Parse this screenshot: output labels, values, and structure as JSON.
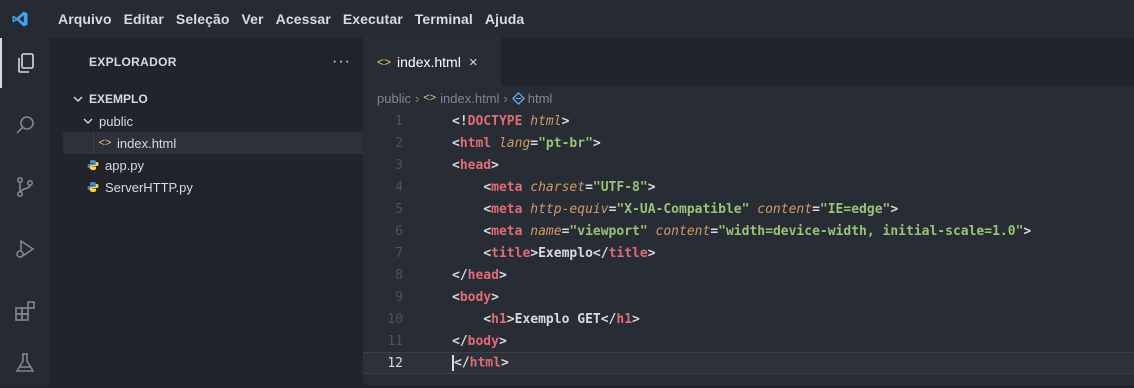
{
  "menu": {
    "items": [
      "Arquivo",
      "Editar",
      "Seleção",
      "Ver",
      "Acessar",
      "Executar",
      "Terminal",
      "Ajuda"
    ]
  },
  "activity_bar": {
    "icons": [
      "explorer-icon",
      "search-icon",
      "source-control-icon",
      "run-debug-icon",
      "extensions-icon",
      "testing-icon"
    ]
  },
  "sidebar": {
    "title": "EXPLORADOR",
    "more": "···",
    "root": "EXEMPLO",
    "folder": "public",
    "files": [
      {
        "label": "index.html",
        "icon": "html-file-icon",
        "indent": 2,
        "selected": true
      },
      {
        "label": "app.py",
        "icon": "python-file-icon",
        "indent": 1,
        "selected": false
      },
      {
        "label": "ServerHTTP.py",
        "icon": "python-file-icon",
        "indent": 1,
        "selected": false
      }
    ]
  },
  "editor": {
    "tab_label": "index.html",
    "tab_close": "×",
    "breadcrumbs": [
      "public",
      "index.html",
      "html"
    ],
    "current_line": 12,
    "lines": [
      {
        "n": "1",
        "tokens": [
          [
            "p",
            "<!"
          ],
          [
            "t",
            "DOCTYPE"
          ],
          [
            "cd",
            " "
          ],
          [
            "a",
            "html"
          ],
          [
            "p",
            ">"
          ]
        ]
      },
      {
        "n": "2",
        "tokens": [
          [
            "p",
            "<"
          ],
          [
            "t",
            "html"
          ],
          [
            "cd",
            " "
          ],
          [
            "a",
            "lang"
          ],
          [
            "p",
            "="
          ],
          [
            "s",
            "\"pt-br\""
          ],
          [
            "p",
            ">"
          ]
        ]
      },
      {
        "n": "3",
        "tokens": [
          [
            "p",
            "<"
          ],
          [
            "t",
            "head"
          ],
          [
            "p",
            ">"
          ]
        ]
      },
      {
        "n": "4",
        "tokens": [
          [
            "cd",
            "    "
          ],
          [
            "p",
            "<"
          ],
          [
            "t",
            "meta"
          ],
          [
            "cd",
            " "
          ],
          [
            "a",
            "charset"
          ],
          [
            "p",
            "="
          ],
          [
            "s",
            "\"UTF-8\""
          ],
          [
            "p",
            ">"
          ]
        ]
      },
      {
        "n": "5",
        "tokens": [
          [
            "cd",
            "    "
          ],
          [
            "p",
            "<"
          ],
          [
            "t",
            "meta"
          ],
          [
            "cd",
            " "
          ],
          [
            "a",
            "http-equiv"
          ],
          [
            "p",
            "="
          ],
          [
            "s",
            "\"X-UA-Compatible\""
          ],
          [
            "cd",
            " "
          ],
          [
            "a",
            "content"
          ],
          [
            "p",
            "="
          ],
          [
            "s",
            "\"IE=edge\""
          ],
          [
            "p",
            ">"
          ]
        ]
      },
      {
        "n": "6",
        "tokens": [
          [
            "cd",
            "    "
          ],
          [
            "p",
            "<"
          ],
          [
            "t",
            "meta"
          ],
          [
            "cd",
            " "
          ],
          [
            "a",
            "name"
          ],
          [
            "p",
            "="
          ],
          [
            "s",
            "\"viewport\""
          ],
          [
            "cd",
            " "
          ],
          [
            "a",
            "content"
          ],
          [
            "p",
            "="
          ],
          [
            "s",
            "\"width=device-width, initial-scale=1.0\""
          ],
          [
            "p",
            ">"
          ]
        ]
      },
      {
        "n": "7",
        "tokens": [
          [
            "cd",
            "    "
          ],
          [
            "p",
            "<"
          ],
          [
            "t",
            "title"
          ],
          [
            "p",
            ">"
          ],
          [
            "tx",
            "Exemplo"
          ],
          [
            "p",
            "</"
          ],
          [
            "t",
            "title"
          ],
          [
            "p",
            ">"
          ]
        ]
      },
      {
        "n": "8",
        "tokens": [
          [
            "p",
            "</"
          ],
          [
            "t",
            "head"
          ],
          [
            "p",
            ">"
          ]
        ]
      },
      {
        "n": "9",
        "tokens": [
          [
            "p",
            "<"
          ],
          [
            "t",
            "body"
          ],
          [
            "p",
            ">"
          ]
        ]
      },
      {
        "n": "10",
        "tokens": [
          [
            "cd",
            "    "
          ],
          [
            "p",
            "<"
          ],
          [
            "t",
            "h1"
          ],
          [
            "p",
            ">"
          ],
          [
            "tx",
            "Exemplo GET"
          ],
          [
            "p",
            "</"
          ],
          [
            "t",
            "h1"
          ],
          [
            "p",
            ">"
          ]
        ]
      },
      {
        "n": "11",
        "tokens": [
          [
            "p",
            "</"
          ],
          [
            "t",
            "body"
          ],
          [
            "p",
            ">"
          ]
        ]
      },
      {
        "n": "12",
        "tokens": [
          [
            "p",
            "</"
          ],
          [
            "t",
            "html"
          ],
          [
            "p",
            ">"
          ]
        ]
      }
    ]
  },
  "colors": {
    "accent": "#e5c07b",
    "tag": "#e06c75",
    "attribute": "#d19a66",
    "string": "#98c379",
    "python_icon": "#4b8bbe"
  }
}
